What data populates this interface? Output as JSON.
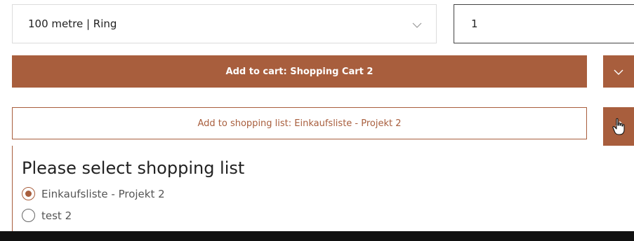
{
  "variant_select": {
    "value": "100 metre | Ring",
    "icon": "chevron-down-icon"
  },
  "quantity": {
    "value": "1"
  },
  "add_to_cart": {
    "label": "Add to cart: Shopping Cart 2",
    "toggle_icon": "chevron-down-icon"
  },
  "add_to_list": {
    "label": "Add to shopping list: Einkaufsliste - Projekt 2",
    "toggle_icon": "chevron-up-icon"
  },
  "list_dropdown": {
    "title": "Please select shopping list",
    "options": [
      {
        "label": "Einkaufsliste - Projekt 2",
        "selected": true
      },
      {
        "label": "test 2",
        "selected": false
      }
    ]
  },
  "colors": {
    "accent": "#a85e3d",
    "bottom_bar": "#111111"
  }
}
